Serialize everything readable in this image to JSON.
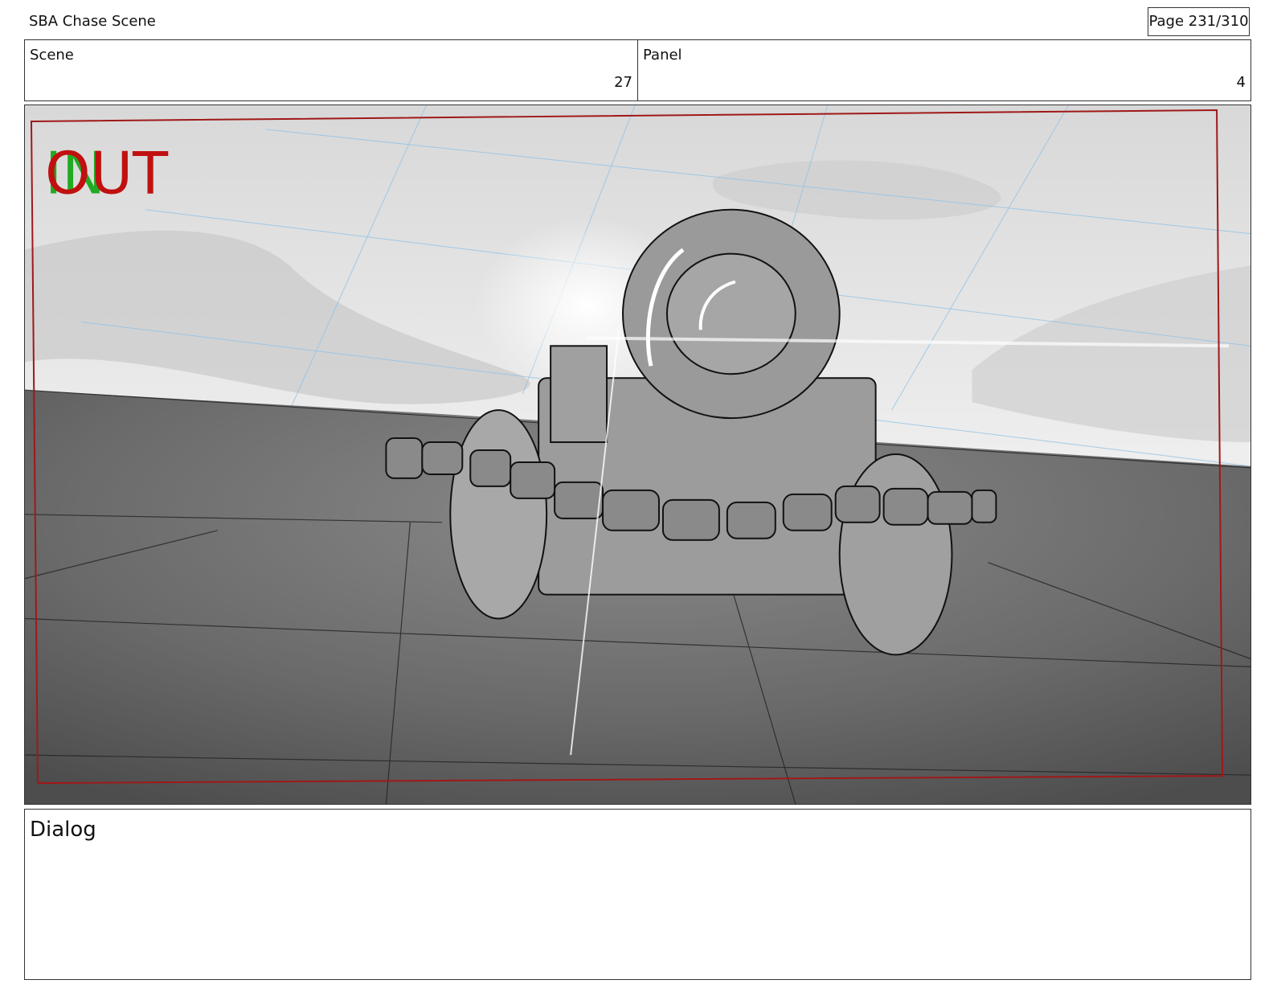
{
  "header": {
    "title": "SBA Chase Scene",
    "page": "Page 231/310"
  },
  "info": {
    "scene_label": "Scene",
    "scene_value": "27",
    "panel_label": "Panel",
    "panel_value": "4"
  },
  "frame": {
    "in_marker": "IN",
    "out_marker": "OUT",
    "in_color": "#22aa22",
    "out_color": "#c01010",
    "safe_frame_color": "#a01818"
  },
  "dialog": {
    "label": "Dialog"
  }
}
